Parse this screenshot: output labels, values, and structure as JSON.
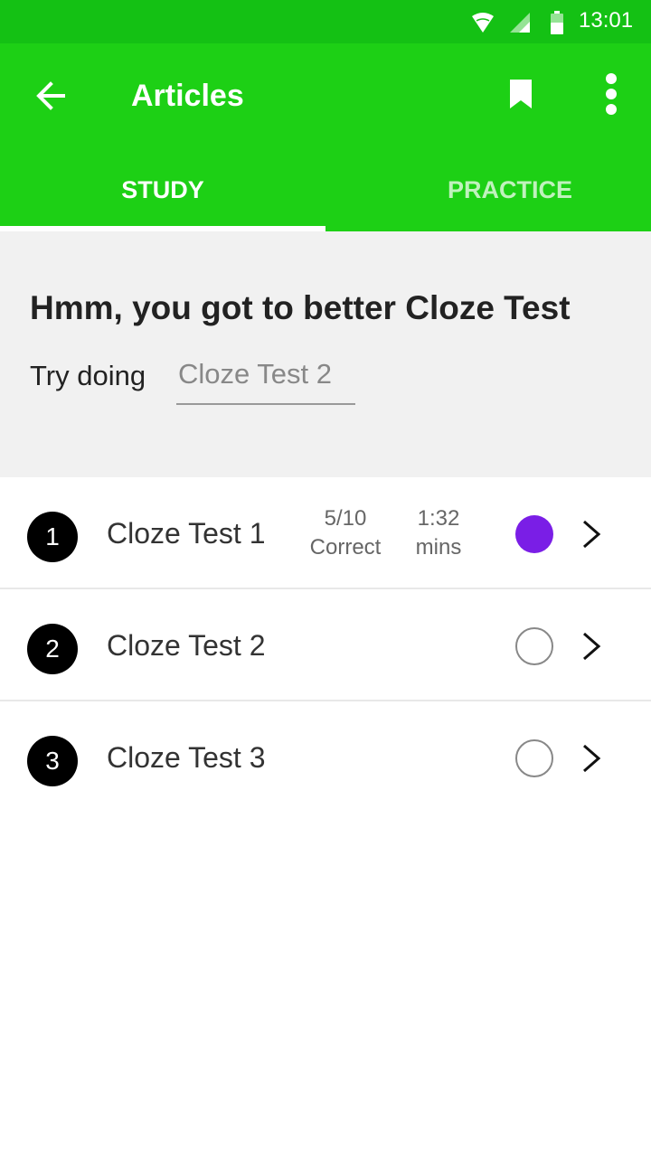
{
  "status_bar": {
    "time": "13:01",
    "icons": [
      "wifi-icon",
      "signal-icon",
      "battery-icon"
    ]
  },
  "app_bar": {
    "title": "Articles",
    "back_icon": "arrow-left-icon",
    "actions": [
      "bookmark-icon",
      "more-vert-icon"
    ]
  },
  "tabs": [
    {
      "label": "STUDY",
      "active": true
    },
    {
      "label": "PRACTICE",
      "active": false
    }
  ],
  "banner": {
    "title": "Hmm, you got to better Cloze Test",
    "try_label": "Try doing",
    "suggestion": "Cloze Test 2"
  },
  "tests": [
    {
      "number": "1",
      "name": "Cloze Test 1",
      "score": "5/10",
      "score_unit": "Correct",
      "time": "1:32",
      "time_unit": "mins",
      "completed": true
    },
    {
      "number": "2",
      "name": "Cloze Test 2",
      "score": "",
      "score_unit": "",
      "time": "",
      "time_unit": "",
      "completed": false
    },
    {
      "number": "3",
      "name": "Cloze Test 3",
      "score": "",
      "score_unit": "",
      "time": "",
      "time_unit": "",
      "completed": false
    }
  ],
  "colors": {
    "status_bar": "#14c114",
    "app_bar": "#1dd015",
    "banner_bg": "#f1f1f1",
    "completed": "#7a1ee6"
  }
}
